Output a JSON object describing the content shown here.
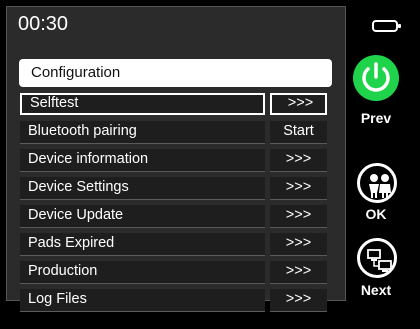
{
  "status_bar": {
    "time": "00:30"
  },
  "menu": {
    "title": "Configuration",
    "items": [
      {
        "label": "Selftest",
        "action": ">>>",
        "selected": true
      },
      {
        "label": "Bluetooth pairing",
        "action": "Start"
      },
      {
        "label": "Device information",
        "action": ">>>"
      },
      {
        "label": "Device Settings",
        "action": ">>>"
      },
      {
        "label": "Device Update",
        "action": ">>>"
      },
      {
        "label": "Pads Expired",
        "action": ">>>"
      },
      {
        "label": "Production",
        "action": ">>>"
      },
      {
        "label": "Log Files",
        "action": ">>>"
      }
    ]
  },
  "side_buttons": {
    "prev_label": "Prev",
    "ok_label": "OK",
    "next_label": "Next"
  },
  "colors": {
    "power_green": "#1fd44a",
    "screen_bg": "#2b2b2b"
  },
  "icons": [
    "battery-icon",
    "power-icon",
    "children-icon",
    "network-icon"
  ]
}
